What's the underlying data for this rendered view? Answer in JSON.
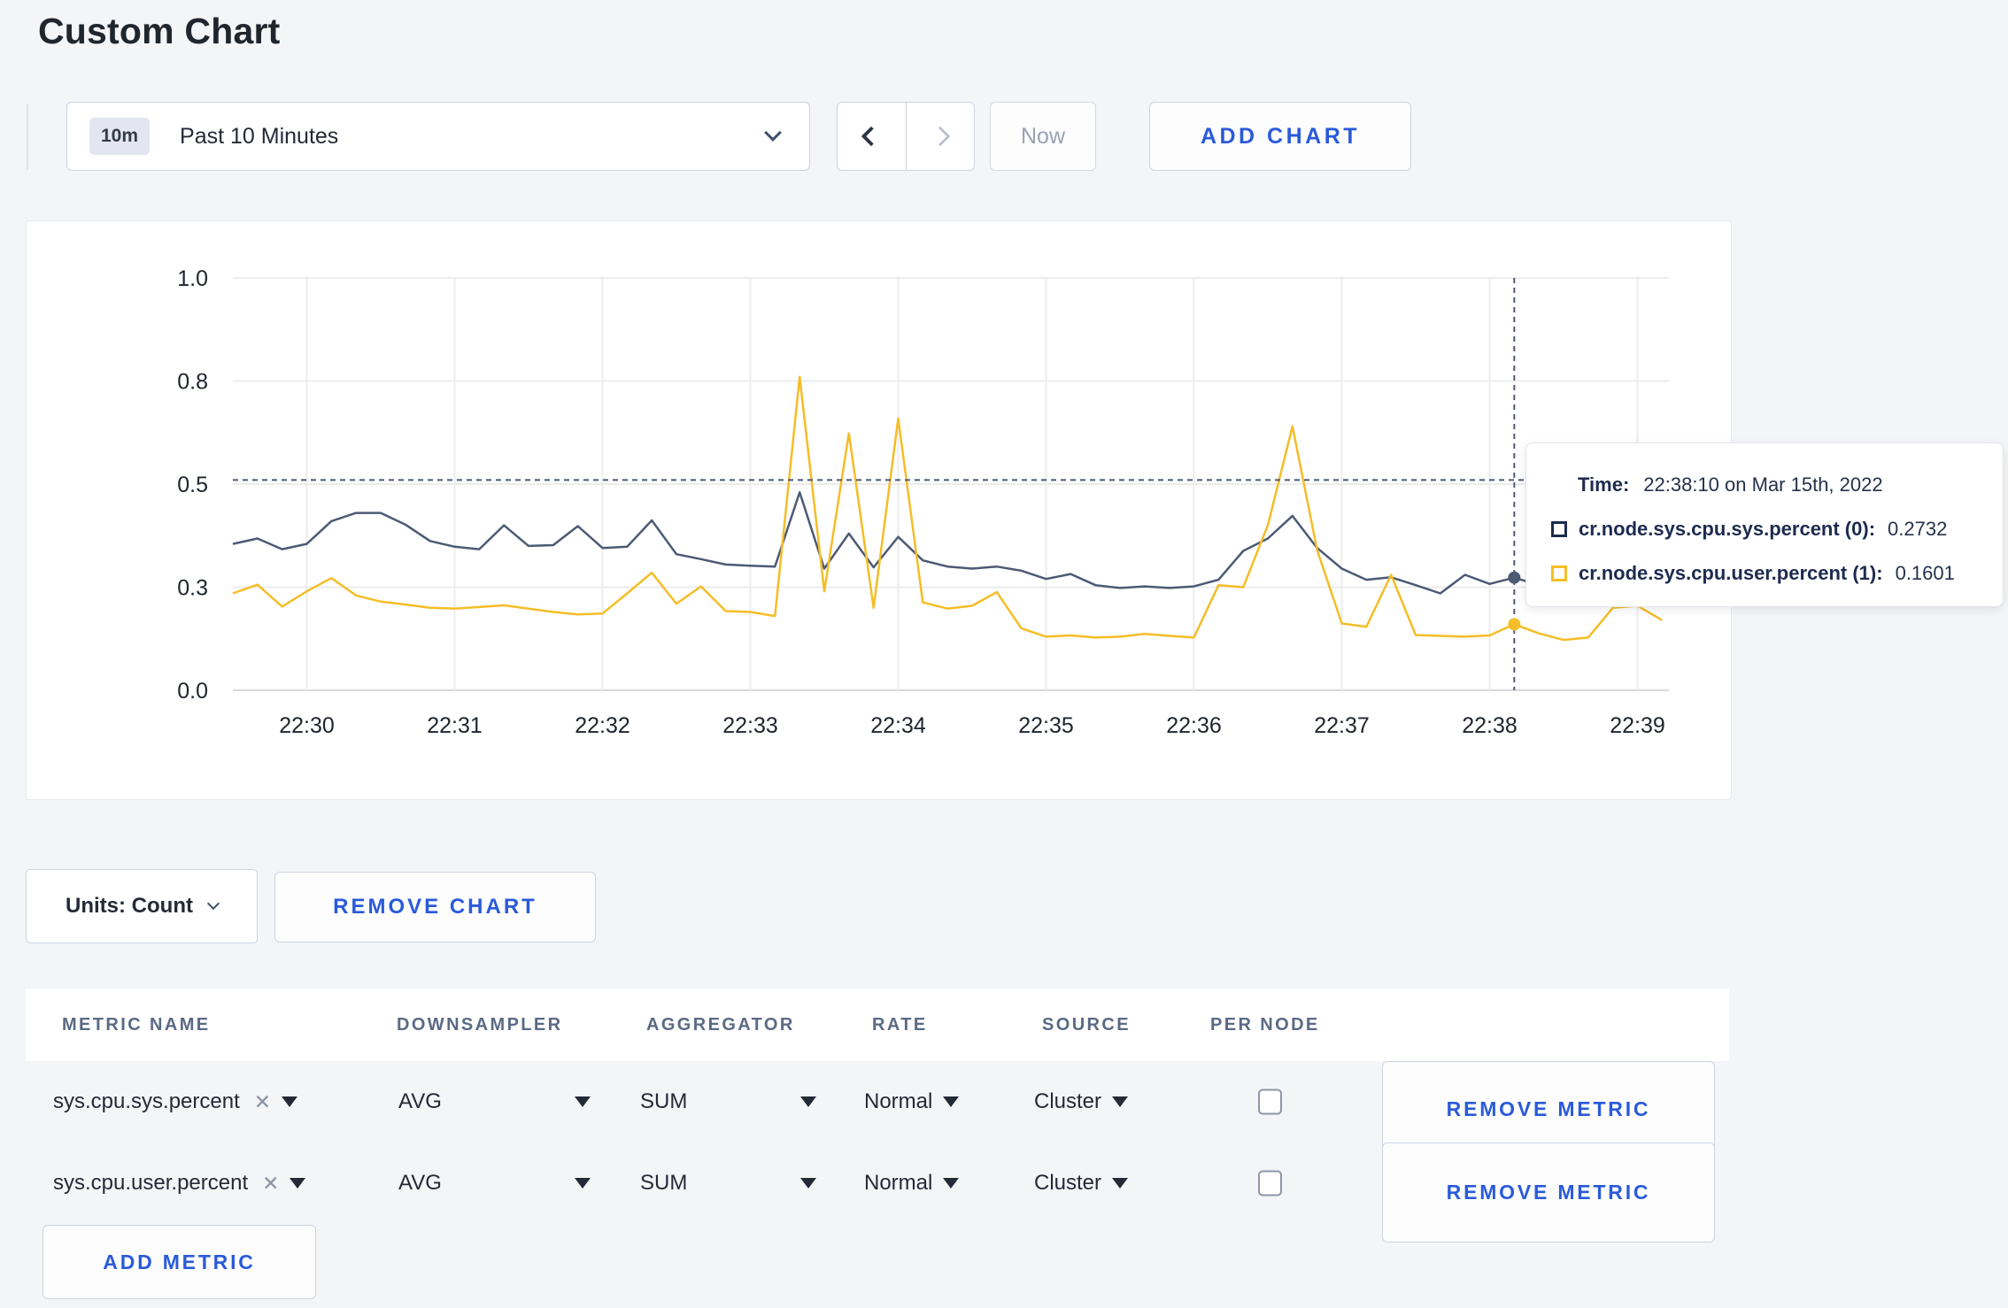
{
  "page": {
    "title": "Custom Chart"
  },
  "toolbar": {
    "range_badge": "10m",
    "range_label": "Past 10 Minutes",
    "prev_icon": "chevron-left",
    "next_icon": "chevron-right",
    "now_label": "Now",
    "add_chart_label": "ADD CHART"
  },
  "tooltip": {
    "time_label": "Time:",
    "time_value": "22:38:10 on Mar 15th, 2022",
    "series": [
      {
        "label": "cr.node.sys.cpu.sys.percent (0):",
        "value": "0.2732",
        "color": "#1b2b4e"
      },
      {
        "label": "cr.node.sys.cpu.user.percent (1):",
        "value": "0.1601",
        "color": "#f5bd27"
      }
    ]
  },
  "chart_controls": {
    "units_label": "Units: Count",
    "remove_chart_label": "REMOVE CHART"
  },
  "metrics_table": {
    "headers": [
      "METRIC NAME",
      "DOWNSAMPLER",
      "AGGREGATOR",
      "RATE",
      "SOURCE",
      "PER NODE"
    ],
    "rows": [
      {
        "metric": "sys.cpu.sys.percent",
        "downsampler": "AVG",
        "aggregator": "SUM",
        "rate": "Normal",
        "source": "Cluster",
        "per_node_checked": false,
        "remove_label": "REMOVE METRIC"
      },
      {
        "metric": "sys.cpu.user.percent",
        "downsampler": "AVG",
        "aggregator": "SUM",
        "rate": "Normal",
        "source": "Cluster",
        "per_node_checked": false,
        "remove_label": "REMOVE METRIC"
      }
    ],
    "add_metric_label": "ADD METRIC"
  },
  "chart_data": {
    "type": "line",
    "title": "",
    "xlabel": "",
    "ylabel": "",
    "ylim": [
      0,
      1
    ],
    "grid": true,
    "y_ticks": {
      "values": [
        0,
        0.25,
        0.5,
        0.75,
        1.0
      ],
      "labels": [
        "0.0",
        "0.3",
        "0.5",
        "0.8",
        "1.0"
      ]
    },
    "x_tick_labels": [
      "22:30",
      "22:31",
      "22:32",
      "22:33",
      "22:34",
      "22:35",
      "22:36",
      "22:37",
      "22:38",
      "22:39"
    ],
    "x": [
      "22:29:30",
      "22:29:40",
      "22:29:50",
      "22:30:00",
      "22:30:10",
      "22:30:20",
      "22:30:30",
      "22:30:40",
      "22:30:50",
      "22:31:00",
      "22:31:10",
      "22:31:20",
      "22:31:30",
      "22:31:40",
      "22:31:50",
      "22:32:00",
      "22:32:10",
      "22:32:20",
      "22:32:30",
      "22:32:40",
      "22:32:50",
      "22:33:00",
      "22:33:10",
      "22:33:20",
      "22:33:30",
      "22:33:40",
      "22:33:50",
      "22:34:00",
      "22:34:10",
      "22:34:20",
      "22:34:30",
      "22:34:40",
      "22:34:50",
      "22:35:00",
      "22:35:10",
      "22:35:20",
      "22:35:30",
      "22:35:40",
      "22:35:50",
      "22:36:00",
      "22:36:10",
      "22:36:20",
      "22:36:30",
      "22:36:40",
      "22:36:50",
      "22:37:00",
      "22:37:10",
      "22:37:20",
      "22:37:30",
      "22:37:40",
      "22:37:50",
      "22:38:00",
      "22:38:10",
      "22:38:20",
      "22:38:30",
      "22:38:40",
      "22:38:50",
      "22:39:00",
      "22:39:10"
    ],
    "series": [
      {
        "name": "cr.node.sys.cpu.sys.percent (0)",
        "color": "#4c5a74",
        "values": [
          0.355,
          0.368,
          0.342,
          0.355,
          0.41,
          0.43,
          0.43,
          0.402,
          0.362,
          0.348,
          0.342,
          0.4,
          0.35,
          0.352,
          0.398,
          0.345,
          0.348,
          0.412,
          0.33,
          0.318,
          0.305,
          0.302,
          0.3,
          0.48,
          0.295,
          0.38,
          0.298,
          0.372,
          0.315,
          0.3,
          0.295,
          0.3,
          0.29,
          0.27,
          0.282,
          0.255,
          0.248,
          0.252,
          0.248,
          0.252,
          0.268,
          0.338,
          0.368,
          0.423,
          0.345,
          0.295,
          0.268,
          0.274,
          0.255,
          0.235,
          0.28,
          0.258,
          0.2732,
          0.255,
          0.25,
          0.248,
          0.252,
          0.25,
          0.248
        ]
      },
      {
        "name": "cr.node.sys.cpu.user.percent (1)",
        "color": "#f5bd27",
        "values": [
          0.235,
          0.256,
          0.203,
          0.24,
          0.272,
          0.23,
          0.215,
          0.208,
          0.2,
          0.198,
          0.202,
          0.206,
          0.198,
          0.19,
          0.184,
          0.186,
          0.235,
          0.285,
          0.21,
          0.252,
          0.192,
          0.19,
          0.18,
          0.76,
          0.24,
          0.623,
          0.2,
          0.659,
          0.213,
          0.198,
          0.205,
          0.238,
          0.15,
          0.13,
          0.133,
          0.128,
          0.13,
          0.137,
          0.132,
          0.128,
          0.255,
          0.25,
          0.4,
          0.64,
          0.34,
          0.162,
          0.154,
          0.28,
          0.134,
          0.132,
          0.13,
          0.133,
          0.1601,
          0.138,
          0.122,
          0.128,
          0.2,
          0.205,
          0.17
        ]
      }
    ],
    "crosshair": {
      "time": "22:38:10",
      "hline_value": 0.51,
      "color": "#4c5a74"
    },
    "legend_position": "tooltip"
  }
}
